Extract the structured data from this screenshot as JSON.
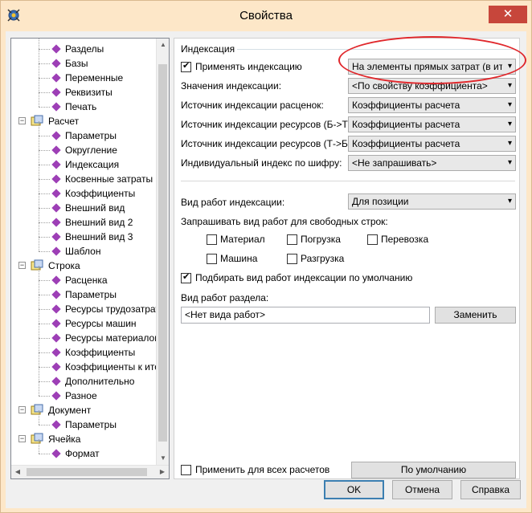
{
  "window": {
    "title": "Свойства",
    "close_glyph": "✕"
  },
  "tree": {
    "nodes": [
      {
        "label": "Разделы"
      },
      {
        "label": "Базы"
      },
      {
        "label": "Переменные"
      },
      {
        "label": "Реквизиты"
      },
      {
        "label": "Печать"
      },
      {
        "label": "Расчет",
        "expander": "−"
      },
      {
        "label": "Параметры"
      },
      {
        "label": "Округление"
      },
      {
        "label": "Индексация"
      },
      {
        "label": "Косвенные затраты"
      },
      {
        "label": "Коэффициенты"
      },
      {
        "label": "Внешний вид"
      },
      {
        "label": "Внешний вид 2"
      },
      {
        "label": "Внешний вид 3"
      },
      {
        "label": "Шаблон"
      },
      {
        "label": "Строка",
        "expander": "−"
      },
      {
        "label": "Расценка"
      },
      {
        "label": "Параметры"
      },
      {
        "label": "Ресурсы трудозатрат"
      },
      {
        "label": "Ресурсы машин"
      },
      {
        "label": "Ресурсы материалов"
      },
      {
        "label": "Коэффициенты"
      },
      {
        "label": "Коэффициенты к итогу"
      },
      {
        "label": "Дополнительно"
      },
      {
        "label": "Разное"
      },
      {
        "label": "Документ",
        "expander": "−"
      },
      {
        "label": "Параметры"
      },
      {
        "label": "Ячейка",
        "expander": "−"
      },
      {
        "label": "Формат"
      }
    ]
  },
  "indexing": {
    "group_title": "Индексация",
    "apply_label": "Применять индексацию",
    "apply_value": "На элементы прямых затрат (в итог)",
    "values_label": "Значения индексации:",
    "values_value": "<По свойству коэффициента>",
    "source_rates_label": "Источник индексации расценок:",
    "source_rates_value": "Коэффициенты расчета",
    "source_res_bt_label": "Источник индексации ресурсов (Б->Т):",
    "source_res_bt_value": "Коэффициенты расчета",
    "source_res_tb_label": "Источник индексации ресурсов (Т->Б):",
    "source_res_tb_value": "Коэффициенты расчета",
    "individual_label": "Индивидуальный индекс по шифру:",
    "individual_value": "<Не запрашивать>"
  },
  "work_type": {
    "label": "Вид работ индексации:",
    "value": "Для позиции",
    "ask_label": "Запрашивать вид работ для свободных строк:",
    "material": "Материал",
    "loading": "Погрузка",
    "transport": "Перевозка",
    "machine": "Машина",
    "unloading": "Разгрузка",
    "default_checkbox_label": "Подбирать вид работ индексации по умолчанию",
    "section_label": "Вид работ раздела:",
    "section_value": "<Нет вида работ>",
    "replace_button": "Заменить"
  },
  "footer": {
    "apply_all_label": "Применить для всех расчетов",
    "default_button": "По умолчанию"
  },
  "dialog_buttons": {
    "ok": "OK",
    "cancel": "Отмена",
    "help": "Справка"
  },
  "chevron": "▾",
  "colors": {
    "title_bg": "#fde7c8",
    "close_bg": "#c7463b",
    "highlight": "#e0282c"
  }
}
